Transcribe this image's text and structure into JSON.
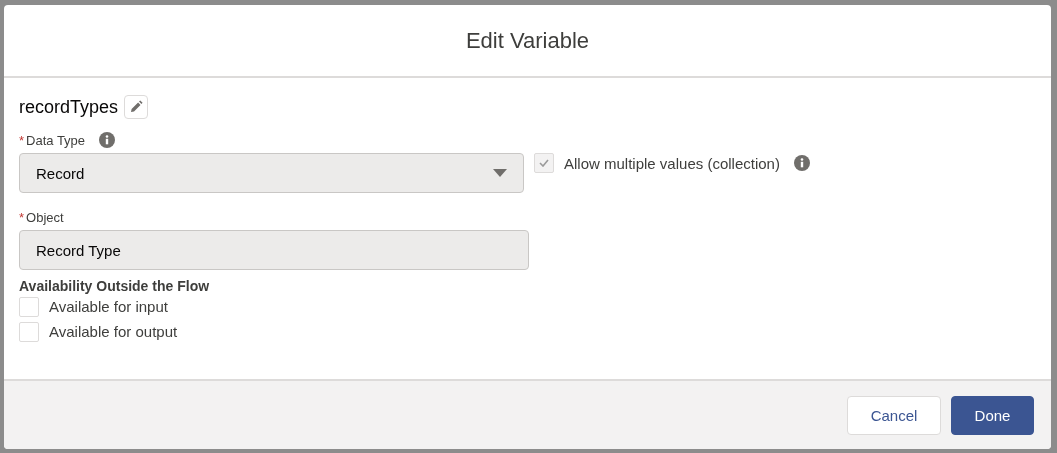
{
  "dialog": {
    "title": "Edit Variable"
  },
  "variable": {
    "name": "recordTypes"
  },
  "data_type": {
    "required_mark": "*",
    "label": "Data Type",
    "value": "Record",
    "disabled": true
  },
  "collection": {
    "label": "Allow multiple values (collection)",
    "checked": true,
    "disabled": true
  },
  "object": {
    "required_mark": "*",
    "label": "Object",
    "value": "Record Type",
    "disabled": true
  },
  "availability": {
    "heading": "Availability Outside the Flow",
    "options": [
      {
        "label": "Available for input",
        "checked": false
      },
      {
        "label": "Available for output",
        "checked": false
      }
    ]
  },
  "buttons": [
    {
      "label": "Cancel",
      "kind": "neutral"
    },
    {
      "label": "Done",
      "kind": "brand"
    }
  ]
}
